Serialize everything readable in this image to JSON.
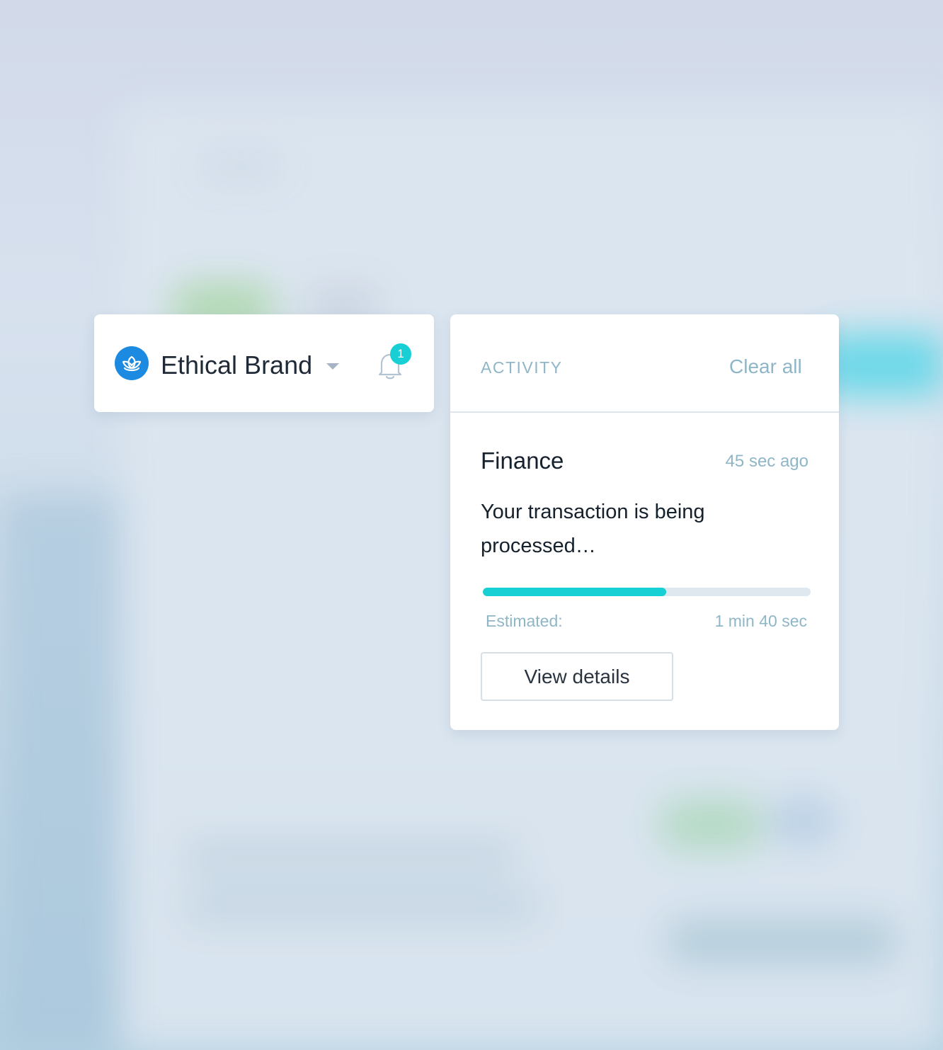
{
  "brand": {
    "name": "Ethical Brand",
    "logo_icon": "lotus-icon",
    "logo_color": "#1b8ae0",
    "dropdown_icon": "caret-down-icon",
    "notifications_icon": "bell-icon",
    "notification_count": "1"
  },
  "activity": {
    "title": "ACTIVITY",
    "clear_all_label": "Clear all",
    "items": [
      {
        "category": "Finance",
        "time": "45 sec ago",
        "message": "Your transaction is being processed…",
        "progress": 0.56,
        "estimate_label": "Estimated:",
        "estimate_value": "1 min 40 sec",
        "button_label": "View details"
      }
    ]
  },
  "colors": {
    "accent": "#16d0d3",
    "muted_text": "#8fb6c7",
    "badge": "#19cfd6"
  }
}
